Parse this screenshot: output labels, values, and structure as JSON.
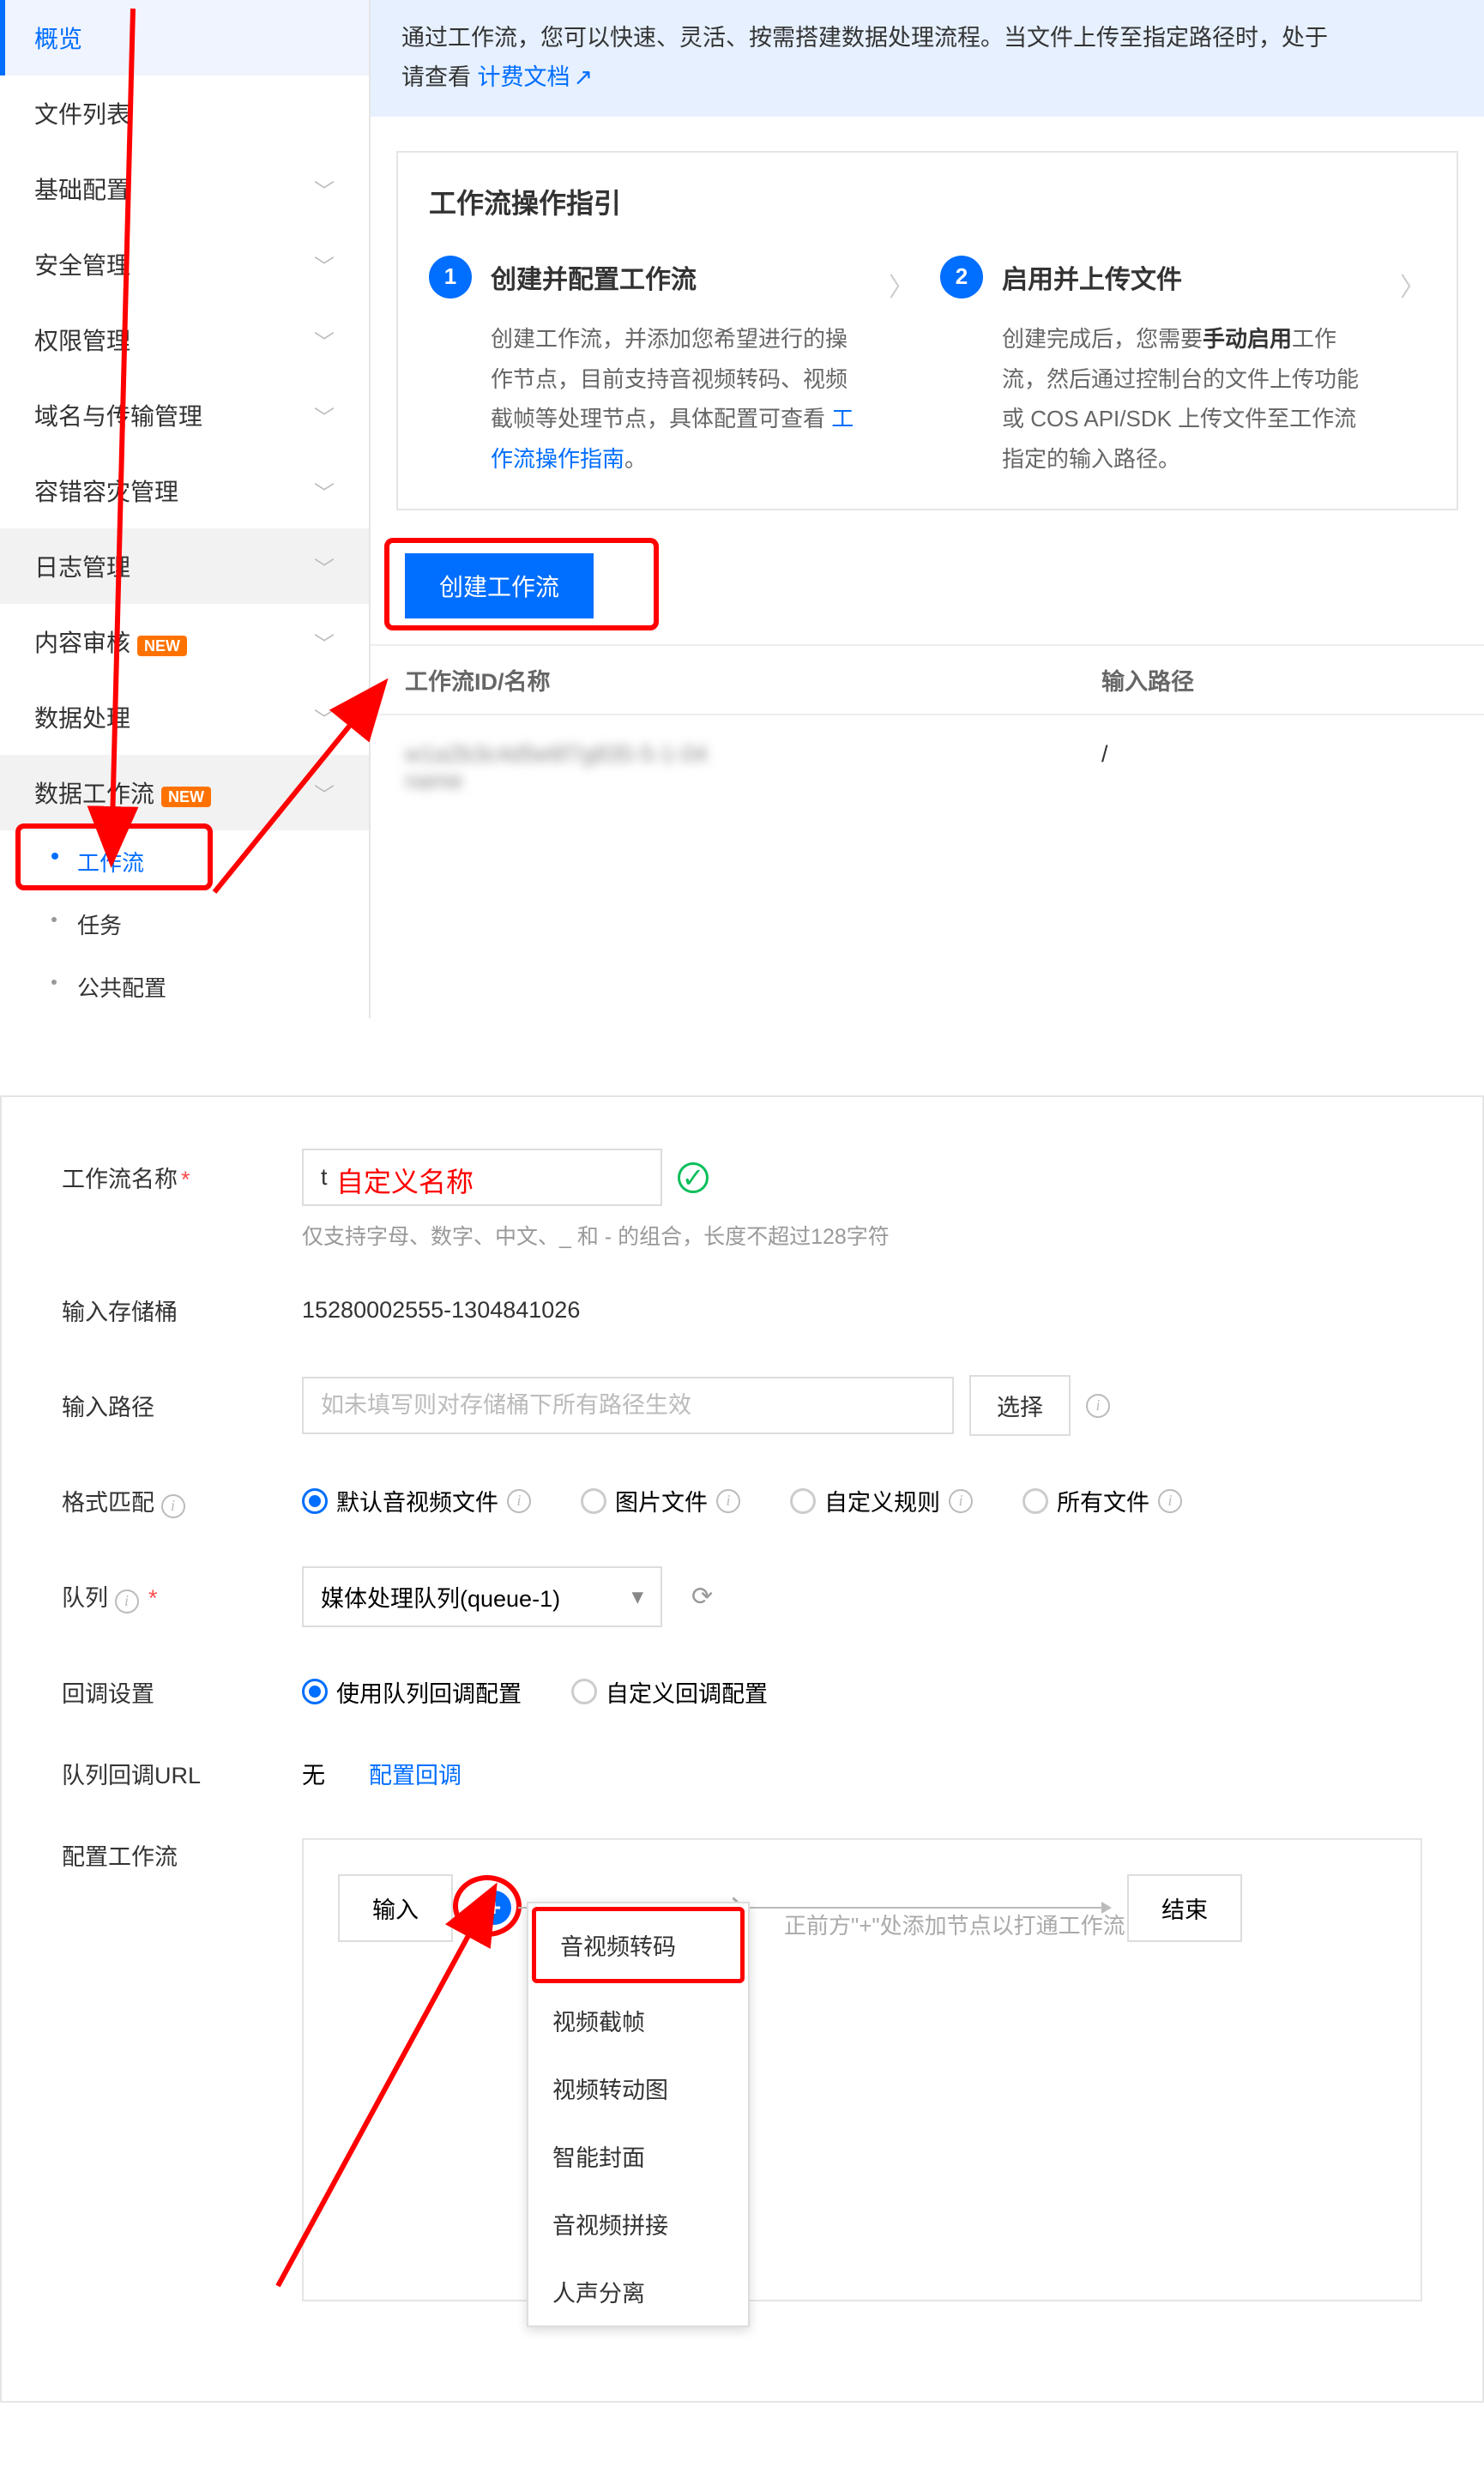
{
  "sidebar": {
    "items": [
      {
        "label": "概览"
      },
      {
        "label": "文件列表"
      },
      {
        "label": "基础配置"
      },
      {
        "label": "安全管理"
      },
      {
        "label": "权限管理"
      },
      {
        "label": "域名与传输管理"
      },
      {
        "label": "容错容灾管理"
      },
      {
        "label": "日志管理"
      },
      {
        "label": "内容审核"
      },
      {
        "label": "数据处理"
      },
      {
        "label": "数据工作流"
      }
    ],
    "sub": [
      {
        "label": "工作流"
      },
      {
        "label": "任务"
      },
      {
        "label": "公共配置"
      }
    ],
    "badge_new": "NEW"
  },
  "notice": {
    "text_a": "通过工作流，您可以快速、灵活、按需搭建数据处理流程。当文件上传至指定路径时，处于",
    "text_b": "请查看 ",
    "link": "计费文档"
  },
  "guide": {
    "title": "工作流操作指引",
    "step1": {
      "num": "1",
      "title": "创建并配置工作流",
      "body_a": "创建工作流，并添加您希望进行的操作节点，目前支持音视频转码、视频截帧等处理节点，具体配置可查看 ",
      "link": "工作流操作指南",
      "body_b": "。"
    },
    "step2": {
      "num": "2",
      "title": "启用并上传文件",
      "body_a": "创建完成后，您需要",
      "bold": "手动启用",
      "body_b": "工作流，然后通过控制台的文件上传功能或 COS API/SDK 上传文件至工作流指定的输入路径。"
    }
  },
  "create_btn": "创建工作流",
  "table": {
    "col1": "工作流ID/名称",
    "col2": "输入路径",
    "row1_col2": "/"
  },
  "form": {
    "name_label": "工作流名称",
    "name_value": "t",
    "name_annotation": "自定义名称",
    "name_hint": "仅支持字母、数字、中文、_ 和 - 的组合，长度不超过128字符",
    "bucket_label": "输入存储桶",
    "bucket_value": "15280002555-1304841026",
    "path_label": "输入路径",
    "path_placeholder": "如未填写则对存储桶下所有路径生效",
    "path_btn": "选择",
    "format_label": "格式匹配",
    "format_opts": [
      "默认音视频文件",
      "图片文件",
      "自定义规则",
      "所有文件"
    ],
    "queue_label": "队列",
    "queue_value": "媒体处理队列(queue-1)",
    "callback_label": "回调设置",
    "callback_opts": [
      "使用队列回调配置",
      "自定义回调配置"
    ],
    "callback_url_label": "队列回调URL",
    "callback_url_none": "无",
    "callback_url_link": "配置回调",
    "config_label": "配置工作流",
    "wf": {
      "input": "输入",
      "end": "结束",
      "hint": "正前方\"+\"处添加节点以打通工作流",
      "menu": [
        "音视频转码",
        "视频截帧",
        "视频转动图",
        "智能封面",
        "音视频拼接",
        "人声分离"
      ]
    }
  }
}
